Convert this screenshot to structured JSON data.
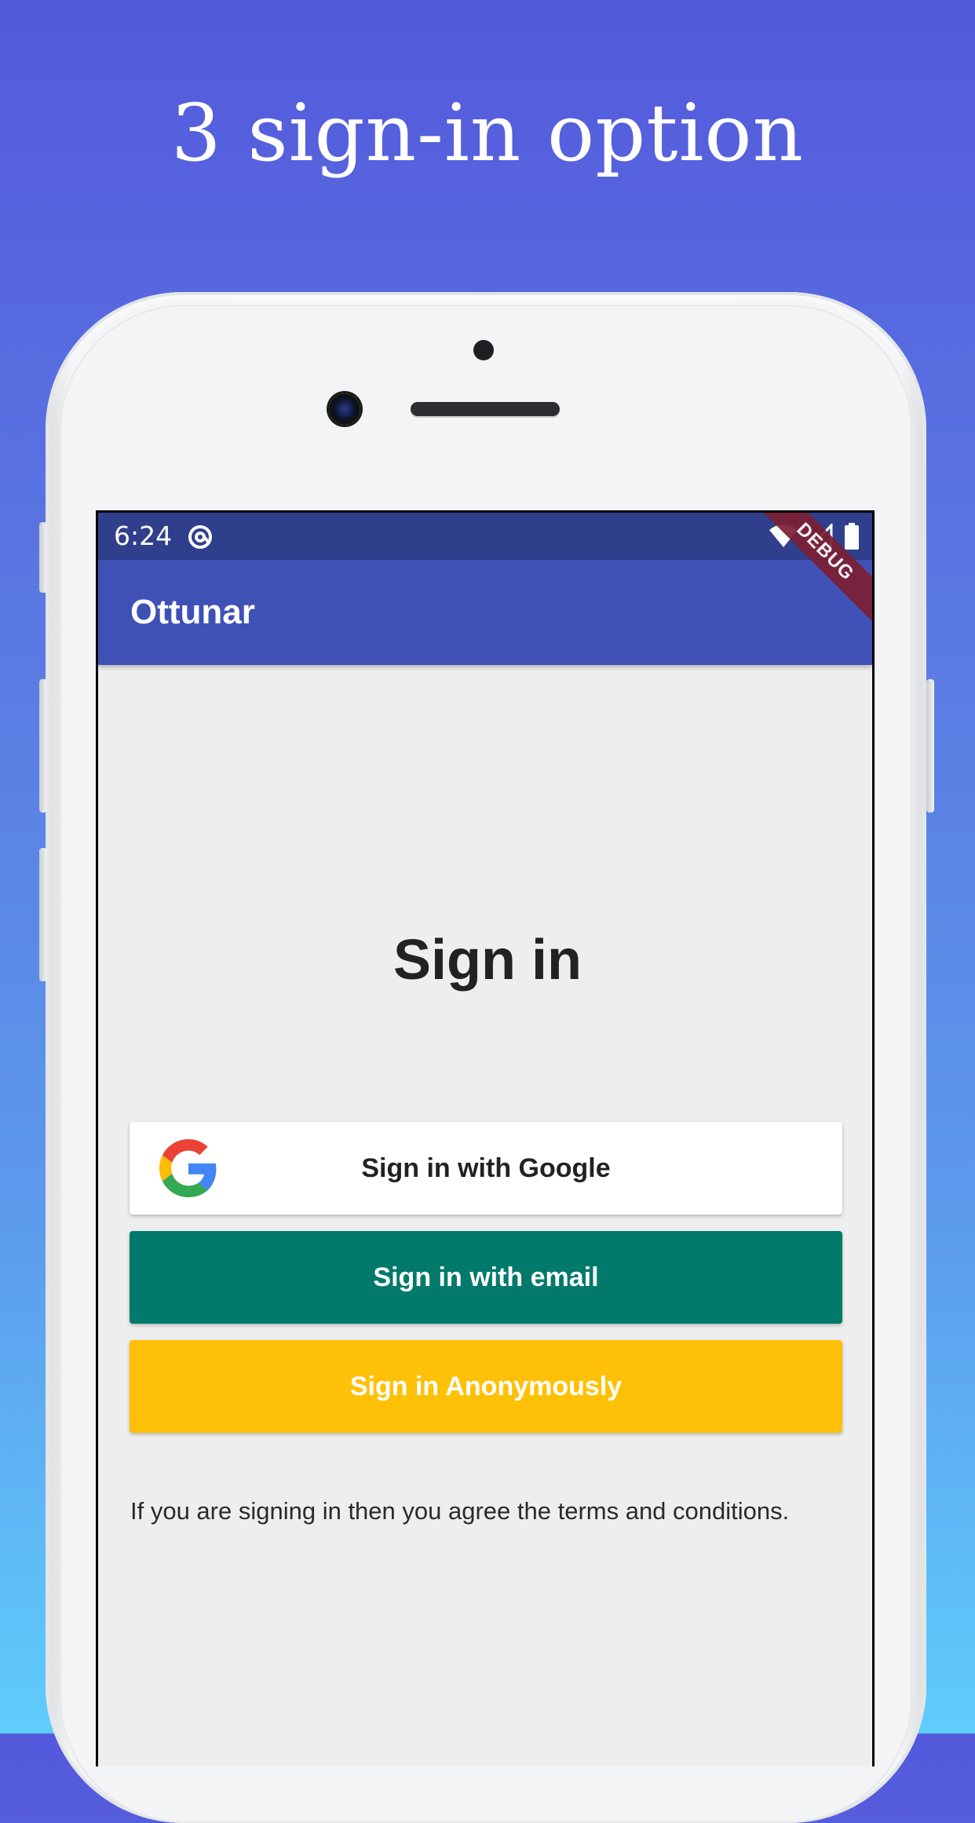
{
  "headline": "3 sign-in option",
  "status_bar": {
    "time": "6:24",
    "icons": [
      "at-sign-icon",
      "wifi-icon",
      "signal-icon",
      "battery-icon"
    ]
  },
  "app_bar": {
    "title": "Ottunar",
    "debug_banner": "DEBUG"
  },
  "page": {
    "title": "Sign in",
    "google_button_label": "Sign in with Google",
    "email_button_label": "Sign in with email",
    "anonymous_button_label": "Sign in Anonymously",
    "terms_text": "If you are signing in then you agree the terms and conditions."
  },
  "colors": {
    "status_bar": "#303f8c",
    "app_bar": "#3f51b5",
    "email_button": "#01796b",
    "anonymous_button": "#ffc107",
    "debug_banner": "#7d1f34"
  }
}
